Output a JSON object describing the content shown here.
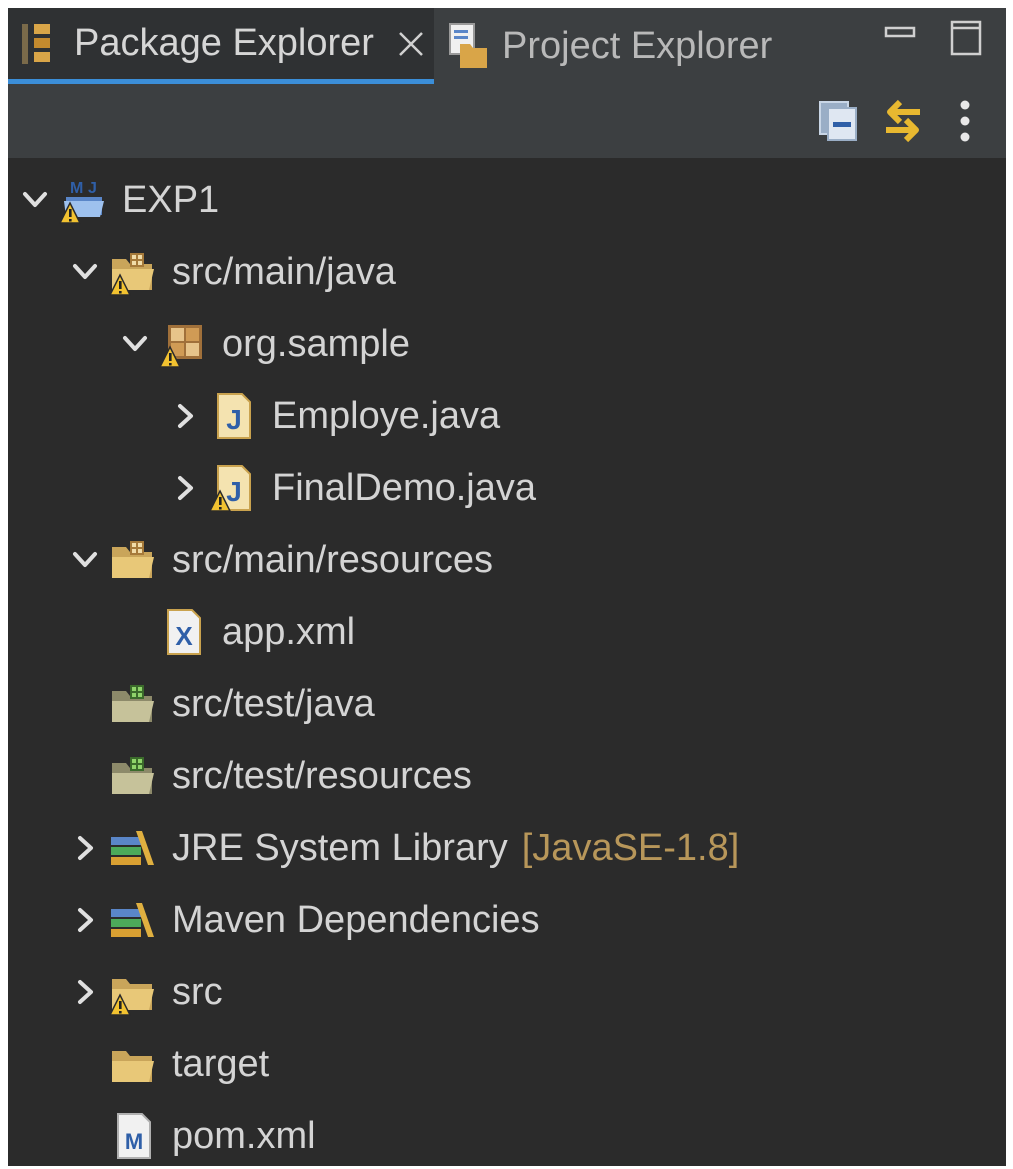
{
  "tabs": [
    {
      "label": "Package Explorer",
      "icon": "package-explorer-icon",
      "active": true
    },
    {
      "label": "Project Explorer",
      "icon": "project-explorer-icon",
      "active": false
    }
  ],
  "colors": {
    "panel_bg": "#2b2b2b",
    "tabbar_bg": "#3c3f41",
    "active_tab_underline": "#3b8ed8",
    "text": "#d4d4d4",
    "decoration_text": "#b8975a"
  },
  "tree": [
    {
      "label": "EXP1",
      "icon": "maven-project-icon",
      "expanded": true,
      "level": 0
    },
    {
      "label": "src/main/java",
      "icon": "source-folder-icon",
      "expanded": true,
      "level": 1
    },
    {
      "label": "org.sample",
      "icon": "package-icon",
      "expanded": true,
      "level": 2
    },
    {
      "label": "Employe.java",
      "icon": "java-file-icon",
      "expanded": false,
      "level": 3
    },
    {
      "label": "FinalDemo.java",
      "icon": "java-file-warning-icon",
      "expanded": false,
      "level": 3
    },
    {
      "label": "src/main/resources",
      "icon": "source-folder-icon",
      "expanded": true,
      "level": 1
    },
    {
      "label": "app.xml",
      "icon": "xml-file-icon",
      "level": 2
    },
    {
      "label": "src/test/java",
      "icon": "test-folder-icon",
      "level": 1
    },
    {
      "label": "src/test/resources",
      "icon": "test-folder-icon",
      "level": 1
    },
    {
      "label": "JRE System Library",
      "decoration": "[JavaSE-1.8]",
      "icon": "library-icon",
      "expanded": false,
      "level": 1
    },
    {
      "label": "Maven Dependencies",
      "icon": "library-icon",
      "expanded": false,
      "level": 1
    },
    {
      "label": "src",
      "icon": "folder-warning-icon",
      "expanded": false,
      "level": 1
    },
    {
      "label": "target",
      "icon": "folder-icon",
      "level": 1
    },
    {
      "label": "pom.xml",
      "icon": "maven-file-icon",
      "level": 1
    }
  ]
}
